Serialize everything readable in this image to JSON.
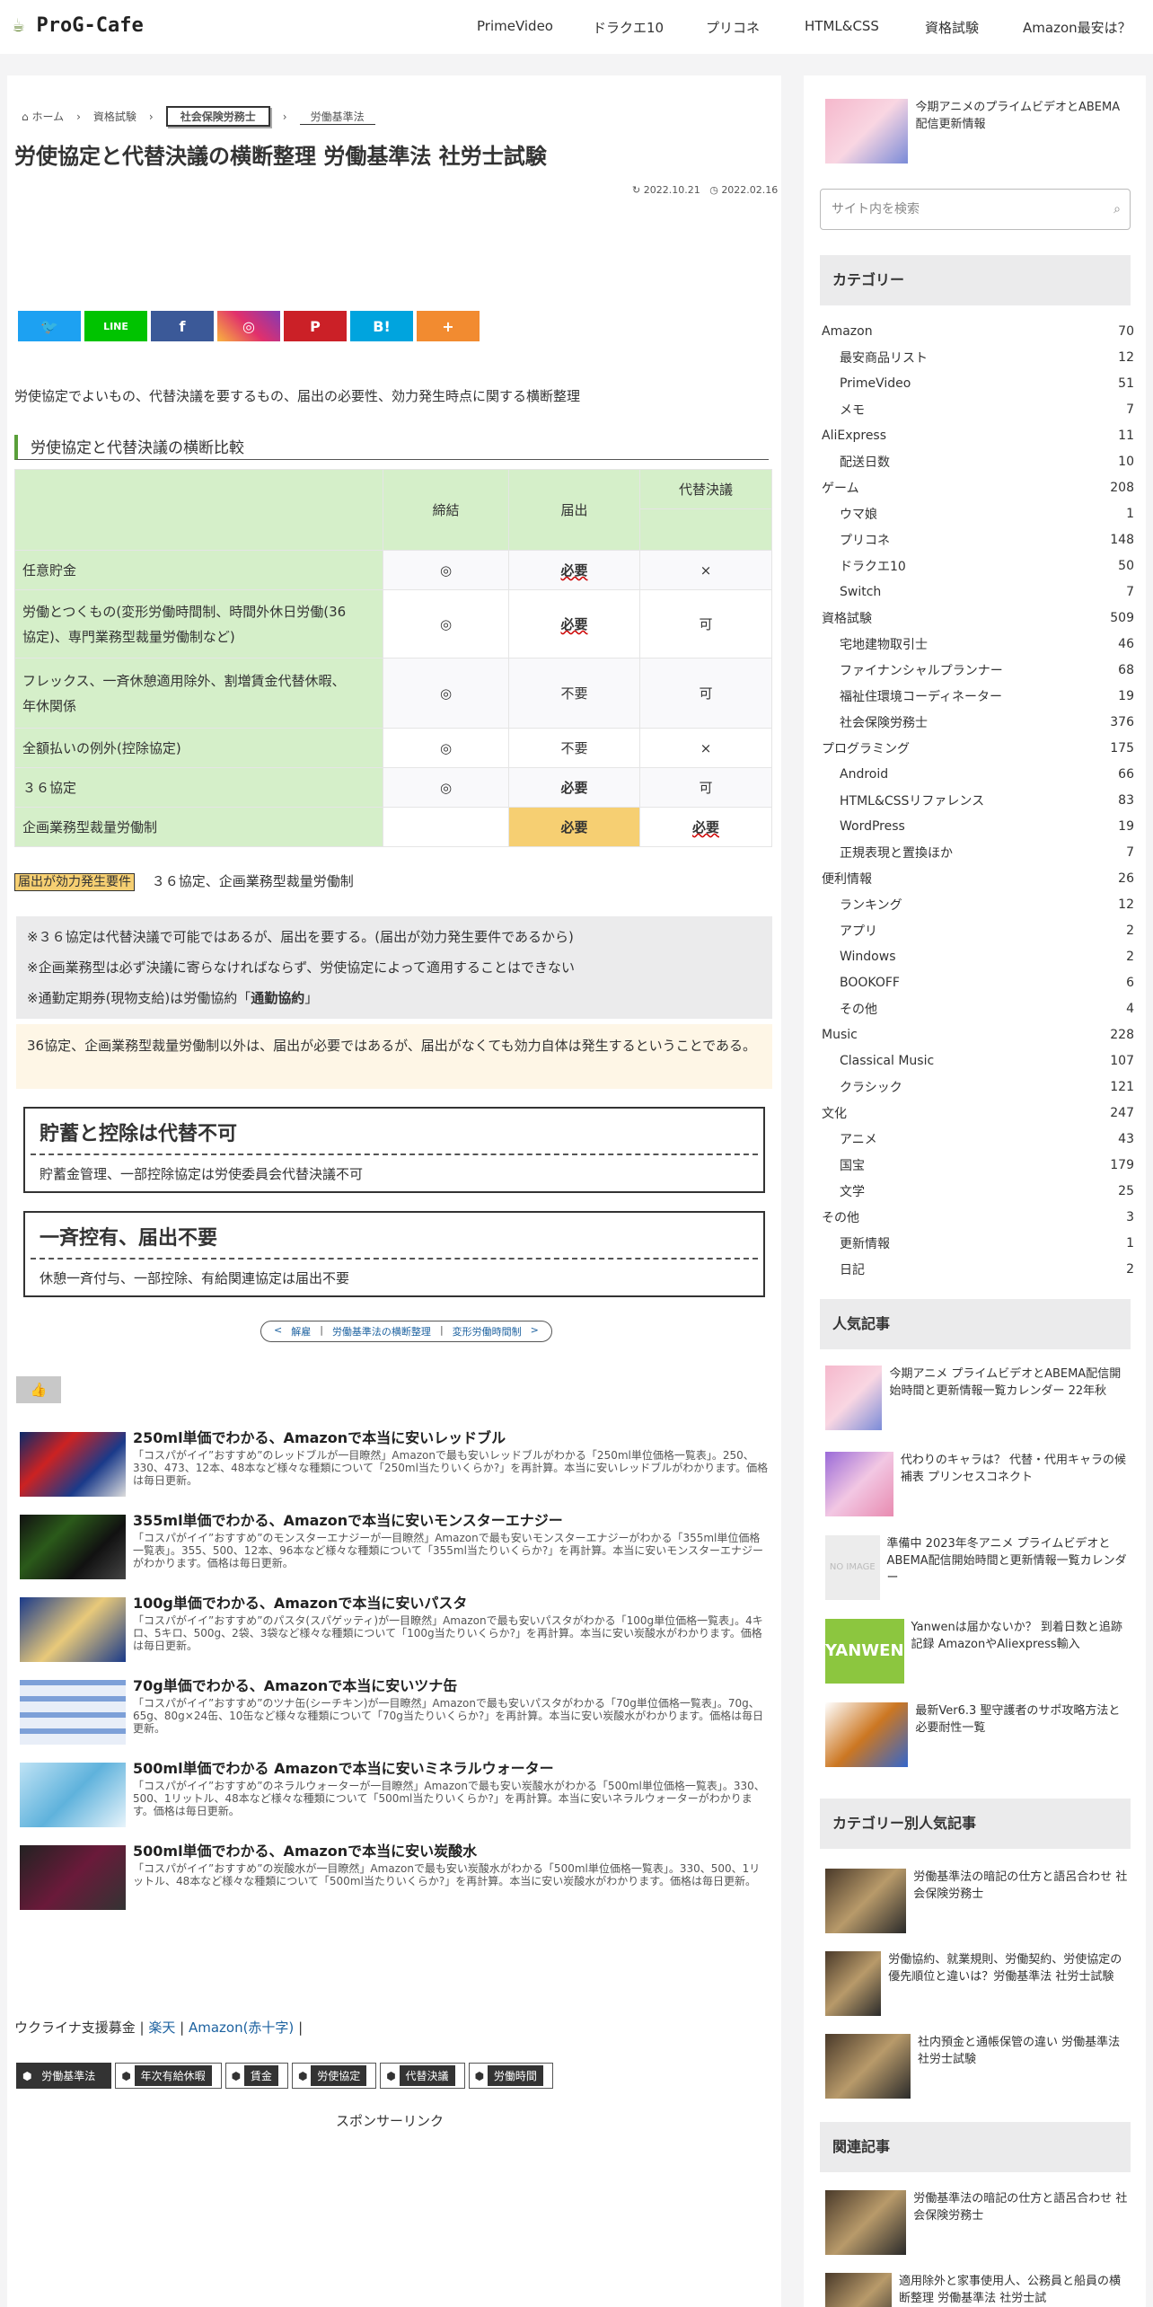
{
  "site": {
    "logo": "ProG-Cafe",
    "nav": [
      "PrimeVideo",
      "ドラクエ10",
      "プリコネ",
      "HTML&CSS",
      "資格試験",
      "Amazon最安は？"
    ]
  },
  "breadcrumb": {
    "home": "ホーム",
    "l1": "資格試験",
    "l2": "社会保険労務士",
    "l3": "労働基準法"
  },
  "article": {
    "title": "労使協定と代替決議の横断整理 労働基準法 社労士試験",
    "published": "2022.10.21",
    "updated": "2022.02.16",
    "share": [
      "🐦",
      "LINE",
      "f",
      "◎",
      "P",
      "B!",
      "+"
    ],
    "intro": "労使協定でよいもの、代替決議を要するもの、届出の必要性、効力発生時点に関する横断整理",
    "h2": "労使協定と代替決議の横断比較",
    "table": {
      "headers": [
        "締結",
        "届出",
        "代替決議"
      ],
      "rows": [
        {
          "label": "任意貯金",
          "a": "◎",
          "b": "必要",
          "c": "×"
        },
        {
          "label1": "労働とつくもの(変形労働時間制、時間外休日労働(36",
          "label2": "協定)、専門業務型裁量労働制など)",
          "a": "◎",
          "b": "必要",
          "c": "可"
        },
        {
          "label1": "フレックス、一斉休憩適用除外、割増賃金代替休暇、",
          "label2": "年休関係",
          "a": "◎",
          "b": "不要",
          "c": "可"
        },
        {
          "label": "全額払いの例外(控除協定)",
          "a": "◎",
          "b": "不要",
          "c": "×"
        },
        {
          "label": "３６協定",
          "a": "◎",
          "b": "必要",
          "c": "可"
        },
        {
          "label": "企画業務型裁量労働制",
          "a": "",
          "b": "必要",
          "c": "必要"
        }
      ]
    },
    "effect_tag": "届出が効力発生要件",
    "effect_text": "３６協定、企画業務型裁量労働制",
    "notes": [
      "※３６協定は代替決議で可能ではあるが、届出を要する。(届出が効力発生要件であるから)",
      "※企画業務型は必ず決議に寄らなければならず、労使協定によって適用することはできない",
      "※通勤定期券(現物支給)は労働協約「",
      "通勤協約",
      "」"
    ],
    "cream": "36協定、企画業務型裁量労働制以外は、届出が必要ではあるが、届出がなくても効力自体は発生するということである。",
    "box1": {
      "title": "貯蓄と控除は代替不可",
      "body": "貯蓄金管理、一部控除協定は労使委員会代替決議不可"
    },
    "box2": {
      "title": "一斉控有、届出不要",
      "body": "休憩一斉付与、一部控除、有給関連協定は届出不要"
    },
    "pager": [
      "<",
      "解雇",
      "|",
      "労働基準法の横断整理",
      "|",
      "変形労働時間制",
      ">"
    ],
    "related": [
      {
        "title": "250ml単価でわかる、Amazonで本当に安いレッドブル",
        "desc": "「コスパがイイ”おすすめ”のレッドブルが一目瞭然」Amazonで最も安いレッドブルがわかる「250ml単位価格一覧表」。250、330、473、12本、48本など様々な種類について「250ml当たりいくらか?」を再計算。本当に安いレッドブルがわかります。価格は毎日更新。"
      },
      {
        "title": "355ml単価でわかる、Amazonで本当に安いモンスターエナジー",
        "desc": "「コスパがイイ”おすすめ”のモンスターエナジーが一目瞭然」Amazonで最も安いモンスターエナジーがわかる「355ml単位価格一覧表」。355、500、12本、96本など様々な種類について「355ml当たりいくらか?」を再計算。本当に安いモンスターエナジーがわかります。価格は毎日更新。"
      },
      {
        "title": "100g単価でわかる、Amazonで本当に安いパスタ",
        "desc": "「コスパがイイ”おすすめ”のパスタ(スパゲッティ)が一目瞭然」Amazonで最も安いパスタがわかる「100g単位価格一覧表」。4キロ、5キロ、500g、2袋、3袋など様々な種類について「100g当たりいくらか?」を再計算。本当に安い炭酸水がわかります。価格は毎日更新。"
      },
      {
        "title": "70g単価でわかる、Amazonで本当に安いツナ缶",
        "desc": "「コスパがイイ”おすすめ”のツナ缶(シーチキン)が一目瞭然」Amazonで最も安いパスタがわかる「70g単位価格一覧表」。70g、65g、80g×24缶、10缶など様々な種類について「70g当たりいくらか?」を再計算。本当に安い炭酸水がわかります。価格は毎日更新。"
      },
      {
        "title": "500ml単価でわかる Amazonで本当に安いミネラルウォーター",
        "desc": "「コスパがイイ”おすすめ”のネラルウォーターが一目瞭然」Amazonで最も安い炭酸水がわかる「500ml単位価格一覧表」。330、500、1リットル、48本など様々な種類について「500ml当たりいくらか?」を再計算。本当に安いネラルウォーターがわかります。価格は毎日更新。"
      },
      {
        "title": "500ml単価でわかる、Amazonで本当に安い炭酸水",
        "desc": "「コスパがイイ”おすすめ”の炭酸水が一目瞭然」Amazonで最も安い炭酸水がわかる「500ml単位価格一覧表」。330、500、1リットル、48本など様々な種類について「500ml当たりいくらか?」を再計算。本当に安い炭酸水がわかります。価格は毎日更新。"
      }
    ],
    "ukraine": {
      "text": "ウクライナ支援募金 |",
      "l1": "楽天",
      "sep": "|",
      "l2": "Amazon(赤十字)",
      "end": "|"
    },
    "tags": [
      "労働基準法",
      "年次有給休暇",
      "賃金",
      "労使協定",
      "代替決議",
      "労働時間"
    ],
    "sponsor": "スポンサーリンク"
  },
  "sidebar": {
    "top_article": "今期アニメのプライムビデオとABEMA配信更新情報",
    "search_placeholder": "サイト内を検索",
    "cat_title": "カテゴリー",
    "categories": [
      [
        "Amazon",
        "70",
        0
      ],
      [
        "最安商品リスト",
        "12",
        1
      ],
      [
        "PrimeVideo",
        "51",
        1
      ],
      [
        "メモ",
        "7",
        1
      ],
      [
        "AliExpress",
        "11",
        0
      ],
      [
        "配送日数",
        "10",
        1
      ],
      [
        "ゲーム",
        "208",
        0
      ],
      [
        "ウマ娘",
        "1",
        1
      ],
      [
        "プリコネ",
        "148",
        1
      ],
      [
        "ドラクエ10",
        "50",
        1
      ],
      [
        "Switch",
        "7",
        1
      ],
      [
        "資格試験",
        "509",
        0
      ],
      [
        "宅地建物取引士",
        "46",
        1
      ],
      [
        "ファイナンシャルプランナー",
        "68",
        1
      ],
      [
        "福祉住環境コーディネーター",
        "19",
        1
      ],
      [
        "社会保険労務士",
        "376",
        1
      ],
      [
        "プログラミング",
        "175",
        0
      ],
      [
        "Android",
        "66",
        1
      ],
      [
        "HTML&CSSリファレンス",
        "83",
        1
      ],
      [
        "WordPress",
        "19",
        1
      ],
      [
        "正規表現と置換ほか",
        "7",
        1
      ],
      [
        "便利情報",
        "26",
        0
      ],
      [
        "ランキング",
        "12",
        1
      ],
      [
        "アプリ",
        "2",
        1
      ],
      [
        "Windows",
        "2",
        1
      ],
      [
        "BOOKOFF",
        "6",
        1
      ],
      [
        "その他",
        "4",
        1
      ],
      [
        "Music",
        "228",
        0
      ],
      [
        "Classical Music",
        "107",
        1
      ],
      [
        "クラシック",
        "121",
        1
      ],
      [
        "文化",
        "247",
        0
      ],
      [
        "アニメ",
        "43",
        1
      ],
      [
        "国宝",
        "179",
        1
      ],
      [
        "文学",
        "25",
        1
      ],
      [
        "その他",
        "3",
        0
      ],
      [
        "更新情報",
        "1",
        1
      ],
      [
        "日記",
        "2",
        1
      ]
    ],
    "popular_title": "人気記事",
    "popular": [
      "今期アニメ プライムビデオとABEMA配信開始時間と更新情報一覧カレンダー 22年秋",
      "代わりのキャラは？ 代替・代用キャラの候補表 プリンセスコネクト",
      "準備中 2023年冬アニメ プライムビデオとABEMA配信開始時間と更新情報一覧カレンダー",
      "Yanwenは届かないか？ 到着日数と追跡記録 AmazonやAliexpress輸入",
      "最新Ver6.3 聖守護者のサポ攻略方法と必要耐性一覧"
    ],
    "noimage": "NO IMAGE",
    "catpop_title": "カテゴリー別人気記事",
    "catpop": [
      "労働基準法の暗記の仕方と語呂合わせ 社会保険労務士",
      "労働協約、就業規則、労働契約、労使協定の優先順位と違いは？労働基準法 社労士試験",
      "社内預金と通帳保管の違い 労働基準法 社労士試験"
    ],
    "related_title": "関連記事",
    "related": [
      "労働基準法の暗記の仕方と語呂合わせ 社会保険労務士",
      "適用除外と家事使用人、公務員と船員の横断整理 労働基準法 社労士試"
    ]
  }
}
